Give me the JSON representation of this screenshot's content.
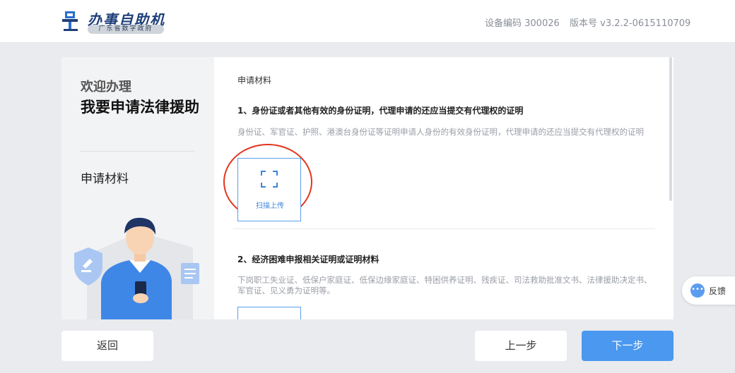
{
  "header": {
    "app_title": "办事自助机",
    "app_subtitle": "广东省数字政府",
    "device_code": "设备编码 300026",
    "version": "版本号 v3.2.2-0615110709"
  },
  "left_panel": {
    "welcome": "欢迎办理",
    "service_name": "我要申请法律援助",
    "current_step": "申请材料"
  },
  "materials": {
    "section_title": "申请材料",
    "items": [
      {
        "title": "1、身份证或者其他有效的身份证明，代理申请的还应当提交有代理权的证明",
        "desc": "身份证、军官证、护照、港澳台身份证等证明申请人身份的有效身份证明，代理申请的还应当提交有代理权的证明",
        "upload_label": "扫描上传"
      },
      {
        "title": "2、经济困难申报相关证明或证明材料",
        "desc": "下岗职工失业证、低保户家庭证、低保边缘家庭证、特困供养证明、残疾证、司法救助批准文书、法律援助决定书、军官证、见义勇为证明等。",
        "upload_label": ""
      }
    ]
  },
  "feedback": {
    "label": "反馈",
    "icon": "chat-bubble-icon"
  },
  "buttons": {
    "back": "返回",
    "prev": "上一步",
    "next": "下一步"
  },
  "colors": {
    "primary": "#4a98f0",
    "highlight_circle": "#e2361f",
    "logo_blue": "#1f3e7a"
  }
}
